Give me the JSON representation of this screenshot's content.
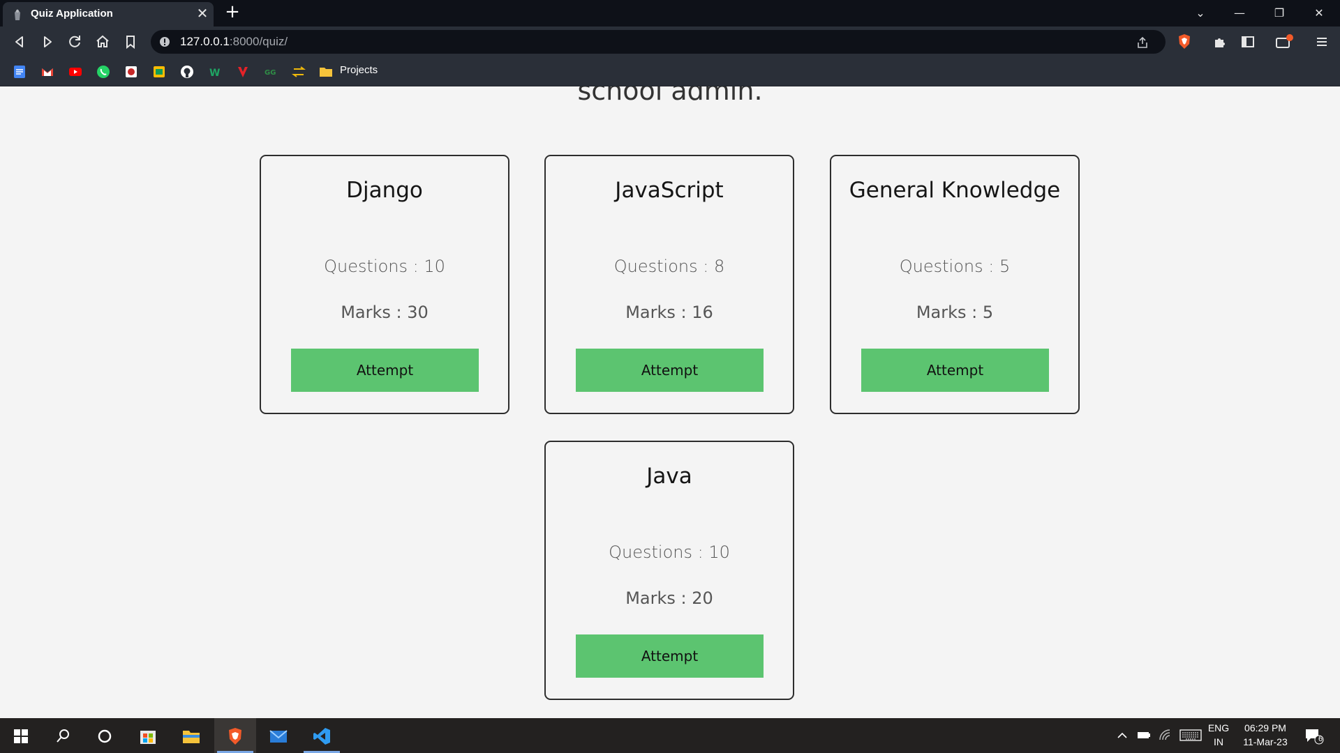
{
  "browser": {
    "tab_title": "Quiz Application",
    "tab_close": "✕",
    "new_tab": "+",
    "window_controls": {
      "tabs_menu": "⌄",
      "minimize": "—",
      "restore": "❐",
      "close": "✕"
    },
    "url_host": "127.0.0.1",
    "url_rest": ":8000/quiz/",
    "bookmarks_folder": "Projects"
  },
  "page": {
    "heading": "school admin."
  },
  "quizzes": [
    {
      "title": "Django",
      "questions": "Questions : 10",
      "marks": "Marks : 30",
      "button": "Attempt"
    },
    {
      "title": "JavaScript",
      "questions": "Questions : 8",
      "marks": "Marks : 16",
      "button": "Attempt"
    },
    {
      "title": "General Knowledge",
      "questions": "Questions : 5",
      "marks": "Marks : 5",
      "button": "Attempt"
    },
    {
      "title": "Java",
      "questions": "Questions : 10",
      "marks": "Marks : 20",
      "button": "Attempt"
    }
  ],
  "taskbar": {
    "lang_top": "ENG",
    "lang_bottom": "IN",
    "time": "06:29 PM",
    "date": "11-Mar-23",
    "notification_count": "6"
  },
  "colors": {
    "attempt_button": "#5cc470",
    "page_background": "#f4f4f4",
    "browser_chrome": "#2a2f38"
  }
}
